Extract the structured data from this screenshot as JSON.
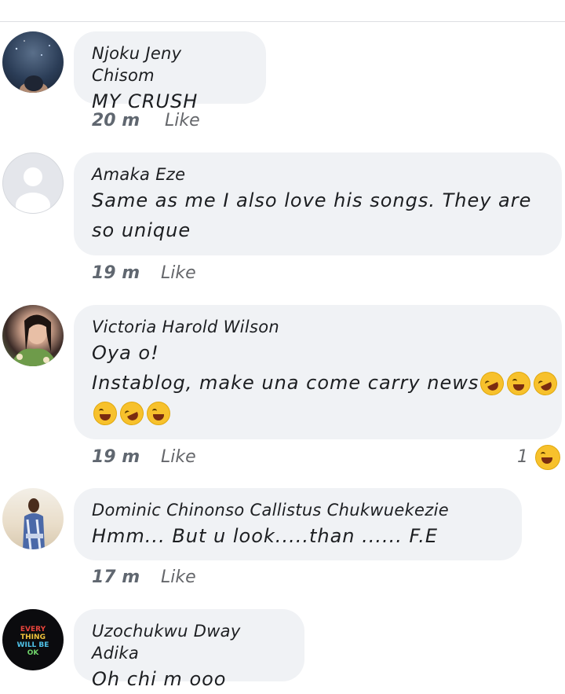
{
  "comments": [
    {
      "author": "Njoku Jeny Chisom",
      "lines": [
        "MY CRUSH"
      ],
      "time": "20 m",
      "like_label": "Like",
      "avatar": "profile-photo"
    },
    {
      "author": "Amaka Eze",
      "lines": [
        "Same as me I also love his songs. They are",
        "so unique"
      ],
      "time": "19 m",
      "like_label": "Like",
      "avatar": "default-avatar-icon"
    },
    {
      "author": "Victoria Harold Wilson",
      "lines": [
        "Oya o!",
        "Instablog, make una come carry news"
      ],
      "emojis_line2": [
        "rolling-laughing-emoji",
        "joy-emoji",
        "rolling-laughing-emoji"
      ],
      "emojis_line3": [
        "joy-emoji",
        "rolling-laughing-emoji",
        "joy-emoji"
      ],
      "time": "19 m",
      "like_label": "Like",
      "reaction_count": "1",
      "reaction_icon": "haha-reaction-icon",
      "avatar": "profile-photo"
    },
    {
      "author": "Dominic Chinonso Callistus Chukwuekezie",
      "lines": [
        "Hmm... But u look.....than ...... F.E"
      ],
      "time": "17 m",
      "like_label": "Like",
      "avatar": "profile-photo"
    },
    {
      "author": "Uzochukwu Dway Adika",
      "lines": [
        "Oh chi m ooo"
      ],
      "avatar": "profile-photo",
      "avatar_text": [
        "EVERY",
        "THING",
        "WILL BE",
        "OK"
      ]
    }
  ],
  "colors": {
    "bubble": "#f0f2f5",
    "meta_text": "#65676b",
    "emoji_yellow": "#f7c12c"
  }
}
